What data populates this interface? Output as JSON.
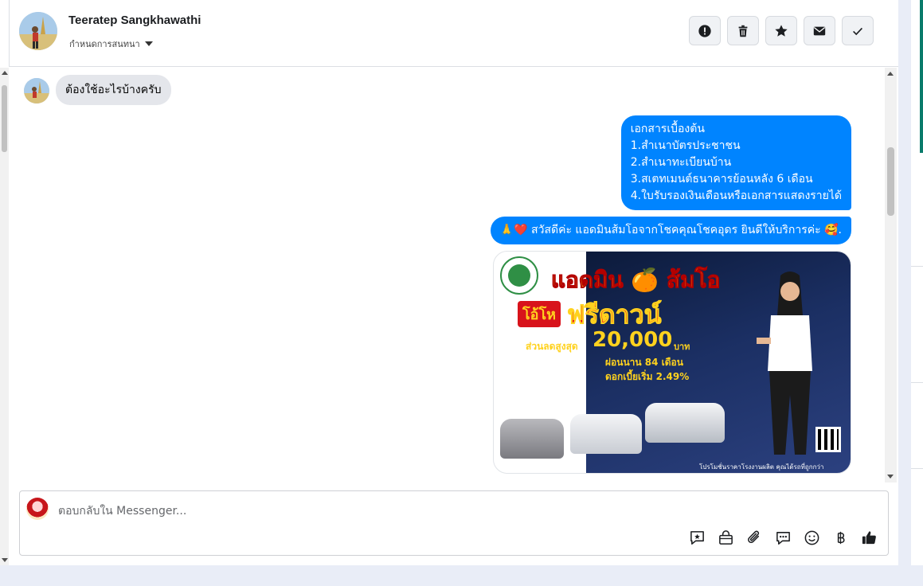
{
  "header": {
    "contact_name": "Teeratep Sangkhawathi",
    "label_action": "กำหนดการสนทนา",
    "actions": [
      {
        "name": "mark-spam-button",
        "icon": "exclamation-icon"
      },
      {
        "name": "delete-button",
        "icon": "trash-icon"
      },
      {
        "name": "star-button",
        "icon": "star-icon"
      },
      {
        "name": "mark-unread-button",
        "icon": "envelope-icon"
      },
      {
        "name": "mark-done-button",
        "icon": "check-icon"
      }
    ]
  },
  "messages": {
    "incoming": {
      "text": "ต้องใช้อะไรบ้างครับ"
    },
    "outgoing_docs": {
      "lines": [
        "เอกสารเบื้องต้น",
        "1.สำเนาบัตรประชาชน",
        "2.สำเนาทะเบียนบ้าน",
        "3.สเตทเมนต์ธนาคารย้อนหลัง 6 เดือน",
        "4.ใบรับรองเงินเดือนหรือเอกสารแสดงรายได้"
      ]
    },
    "outgoing_greeting": {
      "text": "🙏❤️ สวัสดีค่ะ แอดมินส้มโอจากโชคคุณโชคอุดร ยินดีให้บริการค่ะ  🥰."
    },
    "promo_image": {
      "title_left": "แอดมิน",
      "title_right": "ส้มโอ",
      "badge": "โอ้โห",
      "headline": "ฟรีดาวน์",
      "discount_label": "ส่วนลดสูงสุด",
      "discount_value": "20,000",
      "currency": "บาท",
      "installment": "ผ่อนนาน 84 เดือน",
      "interest": "ดอกเบี้ยเริ่ม 2.49%",
      "footer": "โปรโมชั่นราคาโรงงานผลิต คุณได้รถที่ถูกกว่า"
    }
  },
  "composer": {
    "placeholder": "ตอบกลับใน Messenger...",
    "tools": [
      "quick-reply-icon",
      "shop-icon",
      "attach-icon",
      "chat-icon",
      "emoji-icon",
      "baht-icon",
      "like-icon"
    ]
  },
  "colors": {
    "outgoing_bubble": "#0084ff",
    "incoming_bubble": "#e4e6eb",
    "page_background": "#e9edf7",
    "accent": "#0a7b6b"
  }
}
